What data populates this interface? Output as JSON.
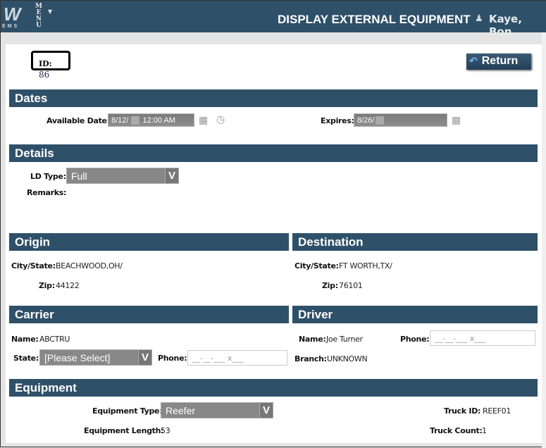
{
  "header": {
    "logo": "W",
    "logo_sub": "EMS",
    "menu": "MENU",
    "title": "DISPLAY EXTERNAL EQUIPMENT",
    "user": "Kaye, Bon"
  },
  "record": {
    "id_label": "ID:",
    "id": "86",
    "return_label": "Return"
  },
  "dates": {
    "title": "Dates",
    "available_label": "Available Date:",
    "available_date": "8/12/",
    "available_time": "12:00 AM",
    "expires_label": "Expires:",
    "expires": "8/26/"
  },
  "details": {
    "title": "Details",
    "ld_type_label": "LD Type:",
    "ld_type": "Full",
    "remarks_label": "Remarks:"
  },
  "origin": {
    "title": "Origin",
    "city_label": "City/State:",
    "city": "BEACHWOOD,OH/",
    "zip_label": "Zip:",
    "zip": "44122"
  },
  "destination": {
    "title": "Destination",
    "city_label": "City/State:",
    "city": "FT WORTH,TX/",
    "zip_label": "Zip:",
    "zip": "76101"
  },
  "carrier": {
    "title": "Carrier",
    "name_label": "Name:",
    "name": "ABCTRU",
    "state_label": "State:",
    "state": "[Please Select]",
    "phone_label": "Phone:",
    "phone_placeholder": "__-__-___ x___"
  },
  "driver": {
    "title": "Driver",
    "name_label": "Name:",
    "name": "Joe Turner",
    "phone_label": "Phone:",
    "phone_placeholder": "__-__-___ x___",
    "branch_label": "Branch:",
    "branch": "UNKNOWN"
  },
  "equipment": {
    "title": "Equipment",
    "type_label": "Equipment Type:",
    "type": "Reefer",
    "length_label": "Equipment Length:",
    "length": "53",
    "truck_id_label": "Truck ID:",
    "truck_id": "REEF01",
    "truck_count_label": "Truck Count:",
    "truck_count": "1"
  }
}
